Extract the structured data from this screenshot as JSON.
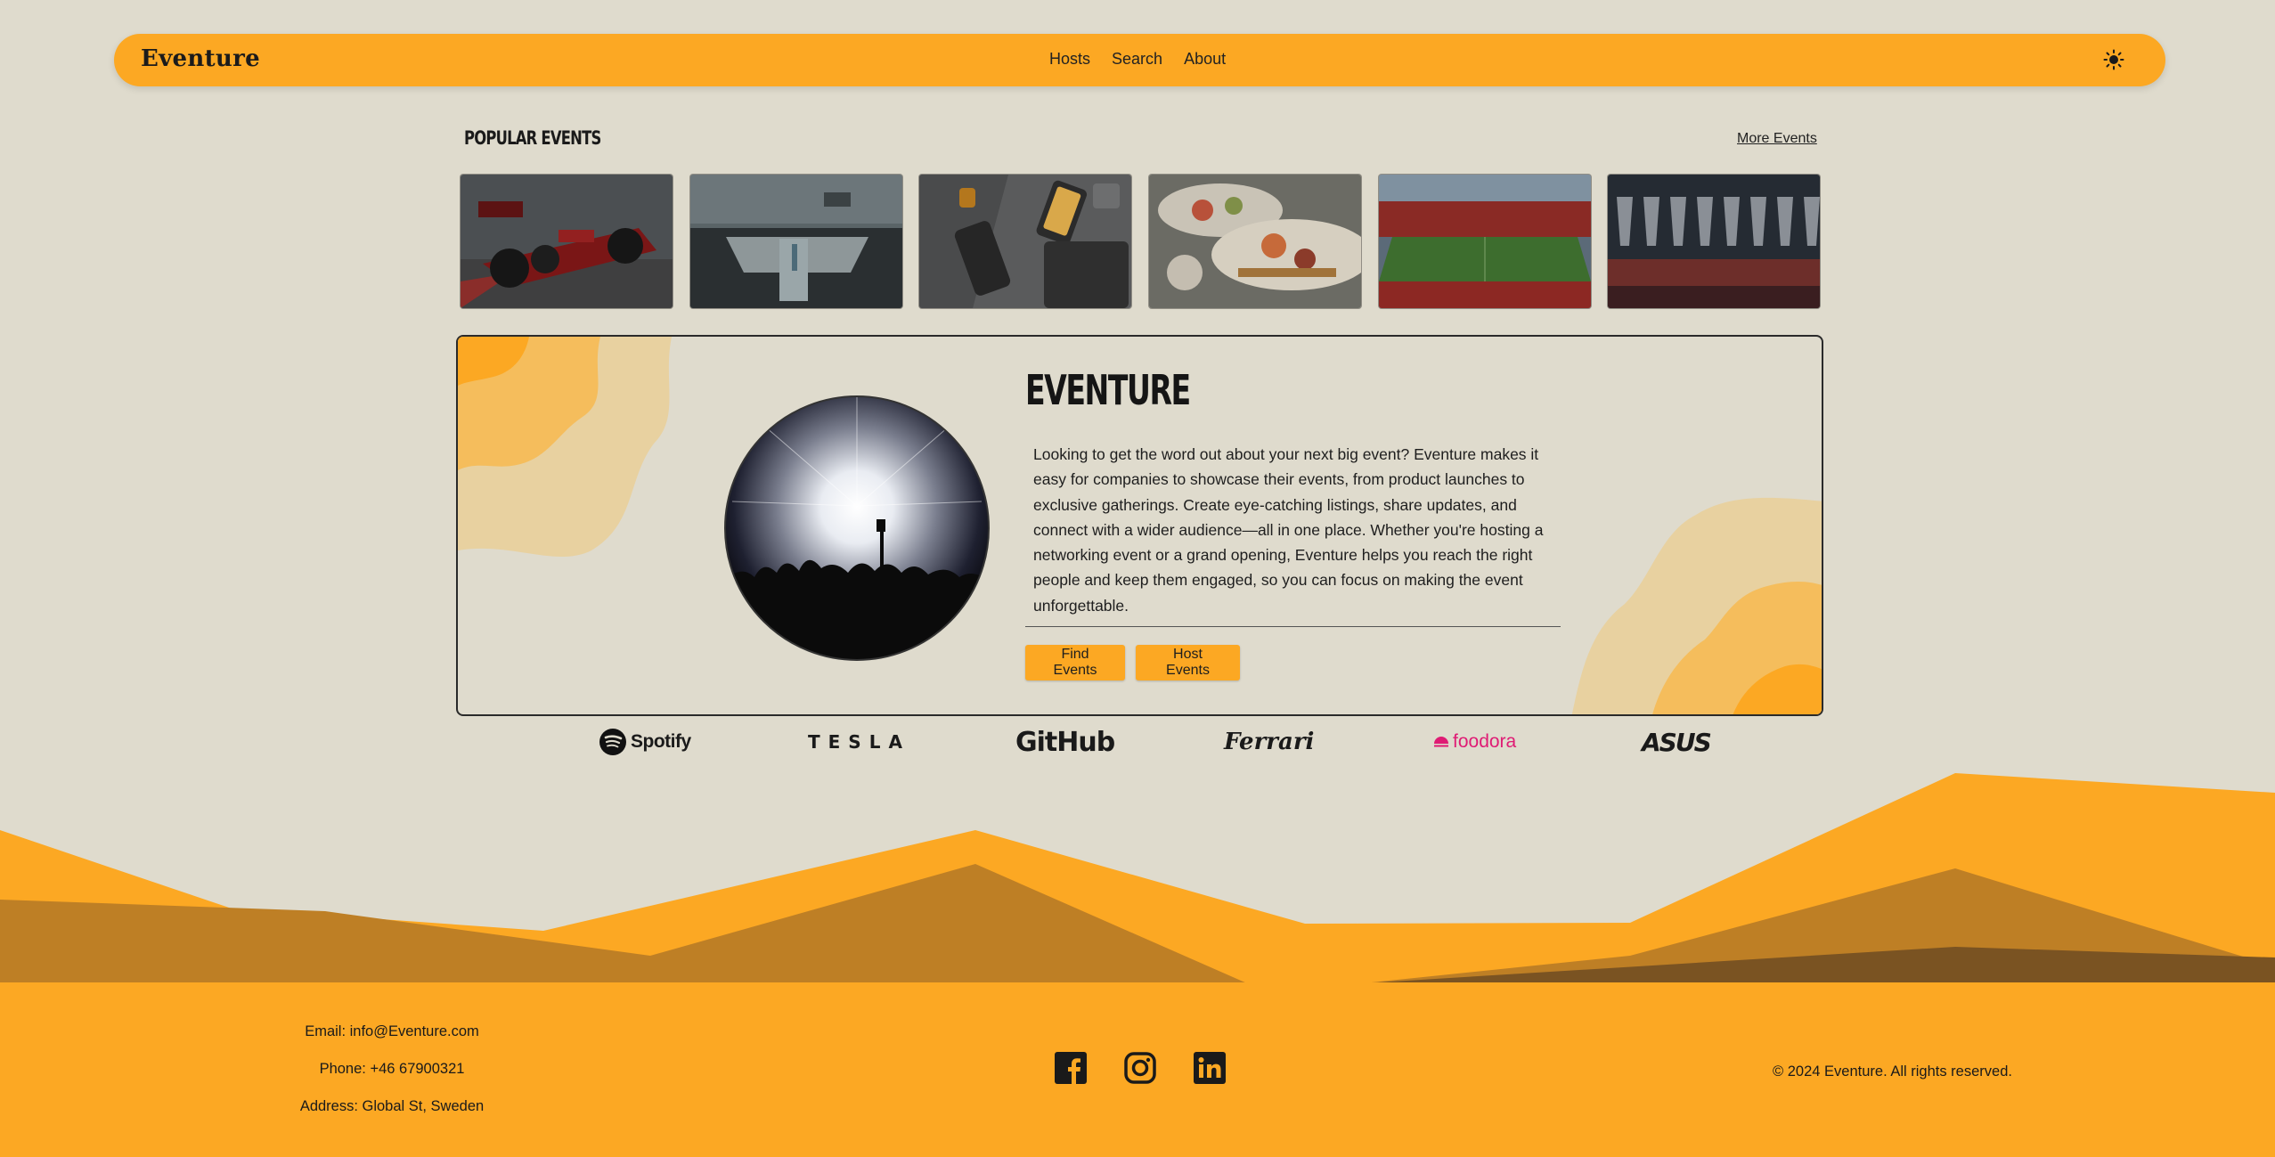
{
  "navbar": {
    "brand": "Eventure",
    "links": [
      "Hosts",
      "Search",
      "About"
    ],
    "theme_icon": "sun-icon"
  },
  "popular": {
    "title": "POPULAR EVENTS",
    "more_label": "More Events",
    "events": [
      {
        "image": "formula-one-car"
      },
      {
        "image": "car-interior-dashboard"
      },
      {
        "image": "apple-devices-flatlay"
      },
      {
        "image": "sushi-platter"
      },
      {
        "image": "football-stadium"
      },
      {
        "image": "wine-glasses"
      }
    ]
  },
  "hero": {
    "title": "EVENTURE",
    "image": "concert-crowd",
    "description": "Looking to get the word out about your next big event? Eventure makes it easy for companies to showcase their events, from product launches to exclusive gatherings. Create eye-catching listings, share updates, and connect with a wider audience—all in one place. Whether you're hosting a networking event or a grand opening, Eventure helps you reach the right people and keep them engaged, so you can focus on making the event unforgettable.",
    "find_label": "Find Events",
    "host_label": "Host Events"
  },
  "partners": [
    "Spotify",
    "TESLA",
    "GitHub",
    "Ferrari",
    "foodora",
    "ASUS"
  ],
  "footer": {
    "email": "Email: info@Eventure.com",
    "phone": "Phone: +46 67900321",
    "address": "Address: Global St, Sweden",
    "socials": [
      "facebook-icon",
      "instagram-icon",
      "linkedin-icon"
    ],
    "copyright": "© 2024 Eventure. All rights reserved."
  },
  "colors": {
    "background": "#dfdbcd",
    "accent": "#fca823",
    "mountain_dark": "#be7f25",
    "mountain_darker": "#7a5322"
  }
}
